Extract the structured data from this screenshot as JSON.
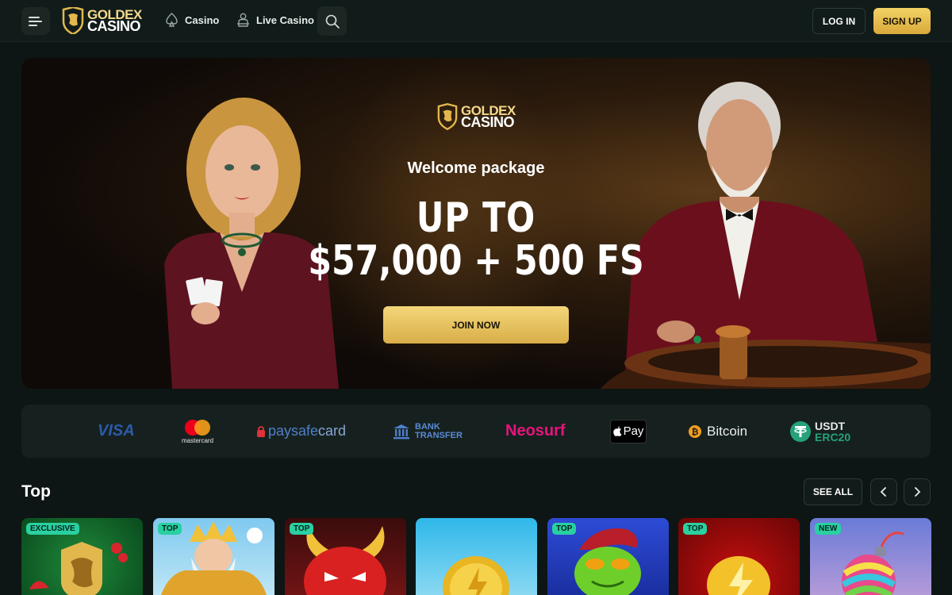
{
  "header": {
    "logo_line1": "GOLDEX",
    "logo_line2": "CASINO",
    "nav": [
      {
        "label": "Casino",
        "icon": "spade-icon"
      },
      {
        "label": "Live Casino",
        "icon": "dealer-icon"
      }
    ],
    "login_label": "LOG IN",
    "signup_label": "SIGN UP"
  },
  "banner": {
    "logo_line1": "GOLDEX",
    "logo_line2": "CASINO",
    "welcome": "Welcome package",
    "headline_line1": "UP TO",
    "headline_line2": "$57,000 + 500 FS",
    "cta": "JOIN NOW"
  },
  "payments": {
    "visa": "VISA",
    "mastercard": "mastercard",
    "paysafe_a": "paysafe",
    "paysafe_b": "card",
    "bank_line1": "BANK",
    "bank_line2": "TRANSFER",
    "neosurf": "Neosurf",
    "applepay": "Pay",
    "bitcoin": "Bitcoin",
    "usdt_line1": "USDT",
    "usdt_line2": "ERC20"
  },
  "top_section": {
    "title": "Top",
    "see_all": "SEE ALL",
    "games": [
      {
        "tag": "EXCLUSIVE",
        "tag_color": "#29d0a0"
      },
      {
        "tag": "TOP",
        "tag_color": "#29d0a0"
      },
      {
        "tag": "TOP",
        "tag_color": "#29d0a0"
      },
      {
        "tag": "",
        "tag_color": ""
      },
      {
        "tag": "TOP",
        "tag_color": "#29d0a0"
      },
      {
        "tag": "TOP",
        "tag_color": "#29d0a0"
      },
      {
        "tag": "NEW",
        "tag_color": "#29d0a0"
      }
    ]
  },
  "colors": {
    "background": "#0d1614",
    "gold": "#e2b84e",
    "accent_green": "#29d0a0"
  }
}
